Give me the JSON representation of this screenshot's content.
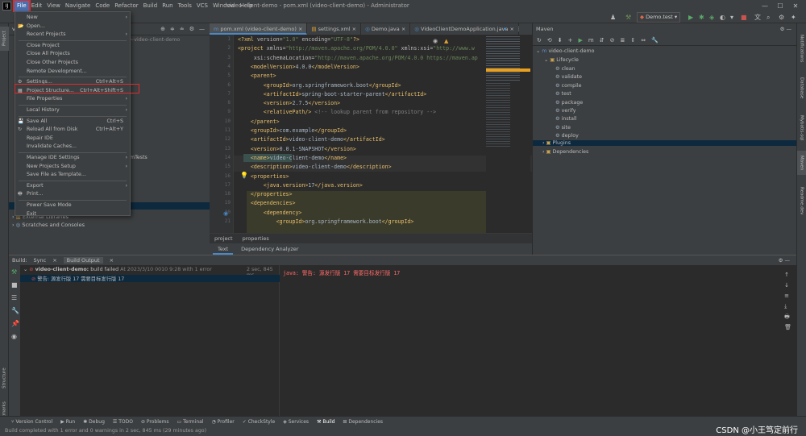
{
  "titlebar": {
    "menus": [
      "File",
      "Edit",
      "View",
      "Navigate",
      "Code",
      "Refactor",
      "Build",
      "Run",
      "Tools",
      "VCS",
      "Window",
      "Help"
    ],
    "title": "video-client-demo - pom.xml (video-client-demo) - Administrator",
    "run_config": "Demo.test"
  },
  "file_menu": {
    "items": [
      {
        "label": "New",
        "shortcut": "",
        "submenu": true
      },
      {
        "label": "Open...",
        "shortcut": "",
        "submenu": false
      },
      {
        "label": "Recent Projects",
        "shortcut": "",
        "submenu": true
      },
      {
        "label": "Close Project",
        "shortcut": "",
        "submenu": false
      },
      {
        "label": "Close All Projects",
        "shortcut": "",
        "submenu": false
      },
      {
        "label": "Close Other Projects",
        "shortcut": "",
        "submenu": false
      },
      {
        "label": "Remote Development...",
        "shortcut": "",
        "submenu": false
      },
      {
        "label": "Settings...",
        "shortcut": "Ctrl+Alt+S",
        "submenu": false
      },
      {
        "label": "Project Structure...",
        "shortcut": "Ctrl+Alt+Shift+S",
        "submenu": false
      },
      {
        "label": "File Properties",
        "shortcut": "",
        "submenu": true
      },
      {
        "label": "Local History",
        "shortcut": "",
        "submenu": true
      },
      {
        "label": "Save All",
        "shortcut": "Ctrl+S",
        "submenu": false
      },
      {
        "label": "Reload All from Disk",
        "shortcut": "Ctrl+Alt+Y",
        "submenu": false
      },
      {
        "label": "Repair IDE",
        "shortcut": "",
        "submenu": false
      },
      {
        "label": "Invalidate Caches...",
        "shortcut": "",
        "submenu": false
      },
      {
        "label": "Manage IDE Settings",
        "shortcut": "",
        "submenu": true
      },
      {
        "label": "New Projects Setup",
        "shortcut": "",
        "submenu": true
      },
      {
        "label": "Save File as Template...",
        "shortcut": "",
        "submenu": false
      },
      {
        "label": "Export",
        "shortcut": "",
        "submenu": true
      },
      {
        "label": "Print...",
        "shortcut": "",
        "submenu": false
      },
      {
        "label": "Power Save Mode",
        "shortcut": "",
        "submenu": false
      },
      {
        "label": "Exit",
        "shortcut": "",
        "submenu": false
      }
    ]
  },
  "project_panel": {
    "title": "vide",
    "header_tail": "~video-client-demo",
    "tests_fragment": "mTests",
    "tree": [
      "External Libraries",
      "Scratches and Consoles"
    ]
  },
  "editor": {
    "tabs": [
      {
        "label": "pom.xml (video-client-demo)",
        "active": true
      },
      {
        "label": "settings.xml",
        "active": false
      },
      {
        "label": "Demo.java",
        "active": false
      },
      {
        "label": "VideoClientDemoApplication.java",
        "active": false
      }
    ],
    "lines": [
      {
        "n": "1",
        "html": "<span class=\"tag\">&lt;?xml</span> <span class=\"attr\">version=</span><span class=\"val\">\"1.0\"</span> <span class=\"attr\">encoding=</span><span class=\"val\">\"UTF-8\"</span><span class=\"tag\">?&gt;</span>"
      },
      {
        "n": "2",
        "html": "<span class=\"tag\">&lt;project</span> <span class=\"attr\">xmlns=</span><span class=\"val\">\"http://maven.apache.org/POM/4.0.0\"</span> <span class=\"attr\">xmlns:xsi=</span><span class=\"val\">\"http://www.w</span>"
      },
      {
        "n": "3",
        "html": "     <span class=\"attr\">xsi:schemaLocation=</span><span class=\"val\">\"http://maven.apache.org/POM/4.0.0 https://maven.ap</span>"
      },
      {
        "n": "4",
        "html": "    <span class=\"tag\">&lt;modelVersion&gt;</span>4.0.0<span class=\"tag\">&lt;/modelVersion&gt;</span>"
      },
      {
        "n": "5",
        "html": "    <span class=\"tag\">&lt;parent&gt;</span>"
      },
      {
        "n": "6",
        "html": "        <span class=\"tag\">&lt;groupId&gt;</span>org.springframework.boot<span class=\"tag\">&lt;/groupId&gt;</span>"
      },
      {
        "n": "7",
        "html": "        <span class=\"tag\">&lt;artifactId&gt;</span>spring-boot-starter-parent<span class=\"tag\">&lt;/artifactId&gt;</span>"
      },
      {
        "n": "8",
        "html": "        <span class=\"tag\">&lt;version&gt;</span>2.7.5<span class=\"tag\">&lt;/version&gt;</span>"
      },
      {
        "n": "9",
        "html": "        <span class=\"tag\">&lt;relativePath/&gt;</span> <span class=\"cmt\">&lt;!-- lookup parent from repository --&gt;</span>"
      },
      {
        "n": "10",
        "html": "    <span class=\"tag\">&lt;/parent&gt;</span>"
      },
      {
        "n": "11",
        "html": "    <span class=\"tag\">&lt;groupId&gt;</span>com.example<span class=\"tag\">&lt;/groupId&gt;</span>"
      },
      {
        "n": "12",
        "html": "    <span class=\"tag\">&lt;artifactId&gt;</span>video-client-demo<span class=\"tag\">&lt;/artifactId&gt;</span>"
      },
      {
        "n": "13",
        "html": "    <span class=\"tag\">&lt;version&gt;</span>0.0.1-SNAPSHOT<span class=\"tag\">&lt;/version&gt;</span>"
      },
      {
        "n": "14",
        "html": "    <span class=\"tag\">&lt;name&gt;</span>video-client-demo<span class=\"tag\">&lt;/name&gt;</span>"
      },
      {
        "n": "15",
        "html": "    <span class=\"tag\">&lt;description&gt;</span>video-client-demo<span class=\"tag\">&lt;/description&gt;</span>"
      },
      {
        "n": "16",
        "html": "    <span class=\"tag\">&lt;properties&gt;</span>"
      },
      {
        "n": "17",
        "html": "        <span class=\"tag\">&lt;java.version&gt;</span>17<span class=\"tag\">&lt;/java.version&gt;</span>"
      },
      {
        "n": "18",
        "html": "    <span class=\"tag\">&lt;/properties&gt;</span>"
      },
      {
        "n": "19",
        "html": "    <span class=\"tag\">&lt;dependencies&gt;</span>"
      },
      {
        "n": "20",
        "html": "        <span class=\"tag\">&lt;dependency&gt;</span>"
      },
      {
        "n": "21",
        "html": "            <span class=\"tag\">&lt;groupId&gt;</span>org.springframework.boot<span class=\"tag\">&lt;/groupId&gt;</span>"
      }
    ],
    "breadcrumb": [
      "project",
      "properties"
    ],
    "bottom_tabs": [
      "Text",
      "Dependency Analyzer"
    ]
  },
  "maven": {
    "title": "Maven",
    "root": "video-client-demo",
    "lifecycle_label": "Lifecycle",
    "lifecycle": [
      "clean",
      "validate",
      "compile",
      "test",
      "package",
      "verify",
      "install",
      "site",
      "deploy"
    ],
    "plugins_label": "Plugins",
    "dependencies_label": "Dependencies"
  },
  "build": {
    "header_label": "Build:",
    "tabs": [
      "Sync",
      "Build Output"
    ],
    "root_label": "video-client-demo:",
    "root_status": "build failed",
    "root_time": "At 2023/3/10 0010 9:28 with 1 error",
    "root_duration": "2 sec, 845 ms",
    "error_item": "警告: 源发行版 17 需要目标发行版 17",
    "output": "java: 警告: 源发行版 17 需要目标发行版 17"
  },
  "bottom_tools": [
    "Version Control",
    "Run",
    "Debug",
    "TODO",
    "Problems",
    "Terminal",
    "Profiler",
    "CheckStyle",
    "Services",
    "Build",
    "Dependencies"
  ],
  "left_strip": [
    "Project",
    "Structure",
    "Bookmarks"
  ],
  "right_strip": [
    "Notifications",
    "Database",
    "Mybatis-sql",
    "Maven",
    "Readme.dev"
  ],
  "status": {
    "text": "Build completed with 1 error and 0 warnings in 2 sec, 845 ms (29 minutes ago)",
    "watermark": "CSDN @小王笃定前行"
  }
}
